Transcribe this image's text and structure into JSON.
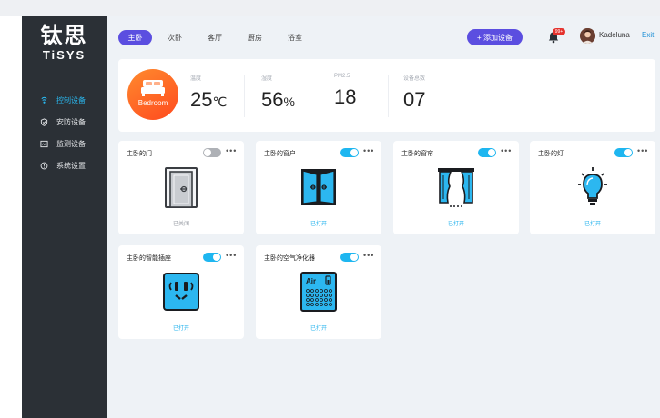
{
  "brand": {
    "name_cn": "钛思",
    "name_en": "TiSYS"
  },
  "sidebar": {
    "items": [
      {
        "label": "控制设备",
        "icon": "control-icon",
        "active": true
      },
      {
        "label": "安防设备",
        "icon": "shield-icon",
        "active": false
      },
      {
        "label": "监测设备",
        "icon": "monitor-icon",
        "active": false
      },
      {
        "label": "系统设置",
        "icon": "settings-icon",
        "active": false
      }
    ]
  },
  "header": {
    "tabs": [
      {
        "label": "主卧",
        "active": true
      },
      {
        "label": "次卧",
        "active": false
      },
      {
        "label": "客厅",
        "active": false
      },
      {
        "label": "厨房",
        "active": false
      },
      {
        "label": "浴室",
        "active": false
      }
    ],
    "add_label": "+ 添加设备",
    "notification_badge": "99+",
    "username": "Kadeluna",
    "exit_label": "Exit"
  },
  "stats": {
    "room_label": "Bedroom",
    "temperature": {
      "label": "温度",
      "value": "25",
      "unit": "℃"
    },
    "humidity": {
      "label": "湿度",
      "value": "56",
      "unit": "%"
    },
    "pm25": {
      "label": "PM2.5",
      "value": "18"
    },
    "device_count": {
      "label": "设备总数",
      "value": "07"
    }
  },
  "devices": [
    {
      "name": "主卧的门",
      "icon": "door-icon",
      "on": false,
      "status": "已关闭"
    },
    {
      "name": "主卧的窗户",
      "icon": "window-icon",
      "on": true,
      "status": "已打开"
    },
    {
      "name": "主卧的窗帘",
      "icon": "curtain-icon",
      "on": true,
      "status": "已打开"
    },
    {
      "name": "主卧的灯",
      "icon": "lightbulb-icon",
      "on": true,
      "status": "已打开"
    },
    {
      "name": "主卧的智能插座",
      "icon": "socket-icon",
      "on": true,
      "status": "已打开"
    },
    {
      "name": "主卧的空气净化器",
      "icon": "air-purifier-icon",
      "on": true,
      "status": "已打开",
      "icon_text": "Air"
    }
  ],
  "more_label": "•••",
  "colors": {
    "accent": "#5b4ee0",
    "toggle_on": "#1eb6f0",
    "sidebar": "#2b3036",
    "room_gradient": "#ff6a22",
    "active_nav": "#29b8f0"
  }
}
